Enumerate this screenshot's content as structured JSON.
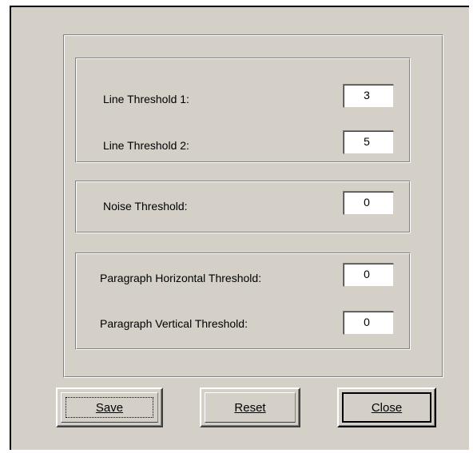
{
  "thresholds": {
    "line_group": {
      "line_threshold_1": {
        "label": "Line Threshold 1:",
        "value": "3"
      },
      "line_threshold_2": {
        "label": "Line Threshold 2:",
        "value": "5"
      }
    },
    "noise_group": {
      "noise_threshold": {
        "label": "Noise Threshold:",
        "value": "0"
      }
    },
    "paragraph_group": {
      "horizontal": {
        "label": "Paragraph Horizontal Threshold:",
        "value": "0"
      },
      "vertical": {
        "label": "Paragraph Vertical Threshold:",
        "value": "0"
      }
    }
  },
  "buttons": {
    "save_label": "Save",
    "reset_label": "Reset",
    "close_label": "Close"
  }
}
